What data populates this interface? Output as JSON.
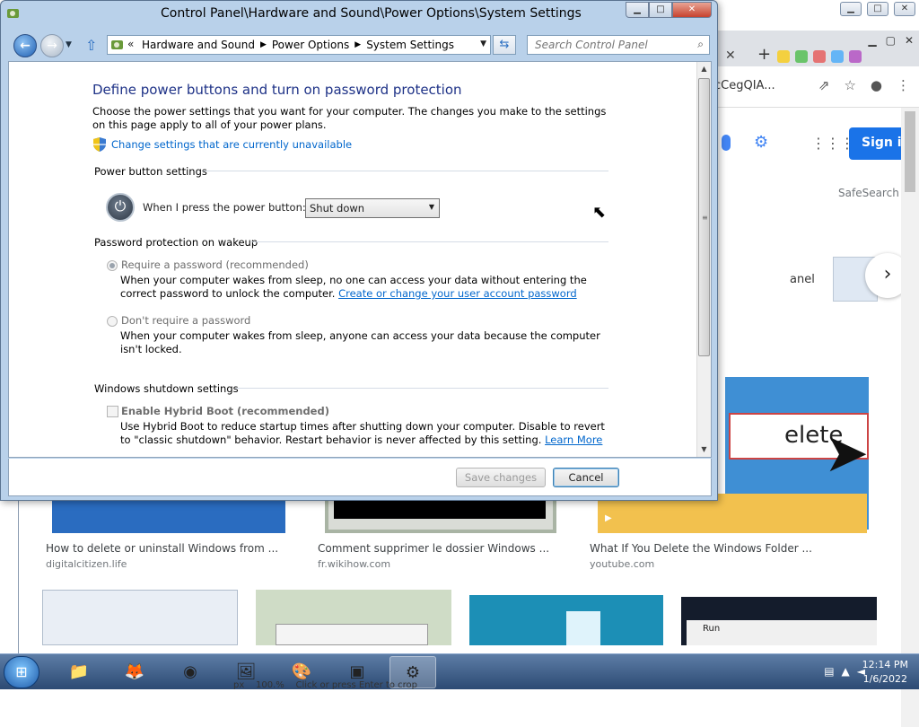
{
  "window": {
    "title": "Control Panel\\Hardware and Sound\\Power Options\\System Settings",
    "minimize": "▁",
    "maximize": "□",
    "close": "✕"
  },
  "nav": {
    "back": "←",
    "forward": "→",
    "up": "⇧",
    "breadcrumbs": [
      "Hardware and Sound",
      "Power Options",
      "System Settings"
    ],
    "search_placeholder": "Search Control Panel"
  },
  "page": {
    "heading": "Define power buttons and turn on password protection",
    "description": "Choose the power settings that you want for your computer. The changes you make to the settings on this page apply to all of your power plans.",
    "change_link": "Change settings that are currently unavailable",
    "power_section": "Power button settings",
    "power_label": "When I press the power button:",
    "power_value": "Shut down",
    "password_section": "Password protection on wakeup",
    "require_label": "Require a password (recommended)",
    "require_desc": "When your computer wakes from sleep, no one can access your data without entering the correct password to unlock the computer.",
    "require_link": "Create or change your user account password",
    "norequire_label": "Don't require a password",
    "norequire_desc": "When your computer wakes from sleep, anyone can access your data because the computer isn't locked.",
    "shutdown_section": "Windows shutdown settings",
    "hybrid_label": "Enable Hybrid Boot (recommended)",
    "hybrid_desc": "Use Hybrid Boot to reduce startup times after shutting down your computer. Disable to revert to \"classic shutdown\" behavior. Restart behavior is never affected by this setting.",
    "learn_more": "Learn More"
  },
  "footer": {
    "save": "Save changes",
    "cancel": "Cancel"
  },
  "browser": {
    "url_fragment": "cCegQIA...",
    "signin": "Sign i",
    "safesearch": "SafeSearch",
    "panel_text": "anel",
    "next_arrow": "›",
    "delete_text": "elete",
    "results": [
      {
        "title": "How to delete or uninstall Windows from ...",
        "source": "digitalcitizen.life"
      },
      {
        "title": "Comment supprimer le dossier Windows ...",
        "source": "fr.wikihow.com"
      },
      {
        "title": "What If You Delete the Windows Folder ...",
        "source": "youtube.com"
      }
    ],
    "run_label": "Run"
  },
  "taskbar": {
    "time": "12:14 PM",
    "date": "1/6/2022",
    "status_text": "Click or press Enter to crop",
    "zoom": "100.%",
    "unit": "px"
  }
}
